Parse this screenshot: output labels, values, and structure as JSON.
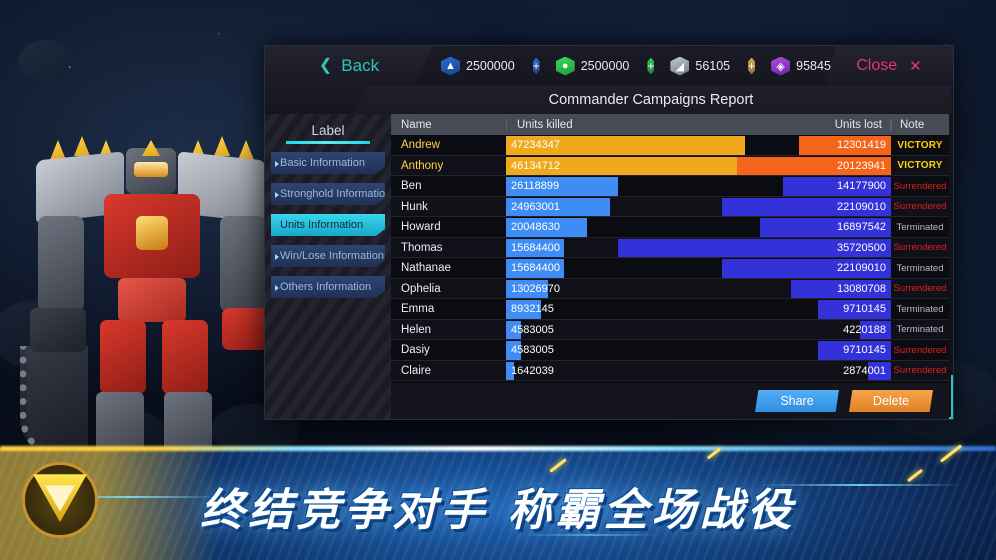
{
  "window": {
    "back_label": "Back",
    "back_icon": "chevron-left-icon",
    "close_label": "Close",
    "close_icon": "close-x-icon",
    "title": "Commander Campaigns Report"
  },
  "resources": [
    {
      "icon": "crystal-blue-icon",
      "value": "2500000",
      "add_label": "+"
    },
    {
      "icon": "gas-green-icon",
      "value": "2500000",
      "add_label": "+"
    },
    {
      "icon": "metal-steel-icon",
      "value": "56105",
      "add_label": "+"
    },
    {
      "icon": "energy-purple-icon",
      "value": "95845",
      "add_label": "+"
    }
  ],
  "sidebar": {
    "header": "Label",
    "items": [
      {
        "label": "Basic Information",
        "active": false
      },
      {
        "label": "Stronghold Information",
        "active": false
      },
      {
        "label": "Units Information",
        "active": true
      },
      {
        "label": "Win/Lose Information",
        "active": false
      },
      {
        "label": "Others Information",
        "active": false
      }
    ]
  },
  "table": {
    "columns": [
      "Name",
      "Units killed",
      "Units lost",
      "Note"
    ],
    "rows": [
      {
        "name": "Andrew",
        "killed": "47234347",
        "lost": "12301419",
        "note": "VICTORY",
        "note_type": "victory",
        "killed_pct": 62,
        "lost_pct": 24
      },
      {
        "name": "Anthony",
        "killed": "46134712",
        "lost": "20123941",
        "note": "VICTORY",
        "note_type": "victory",
        "killed_pct": 60,
        "lost_pct": 40
      },
      {
        "name": "Ben",
        "killed": "26118899",
        "lost": "14177900",
        "note": "Surrendered",
        "note_type": "surrendered",
        "killed_pct": 29,
        "lost_pct": 28
      },
      {
        "name": "Hunk",
        "killed": "24963001",
        "lost": "22109010",
        "note": "Surrendered",
        "note_type": "surrendered",
        "killed_pct": 27,
        "lost_pct": 44
      },
      {
        "name": "Howard",
        "killed": "20048630",
        "lost": "16897542",
        "note": "Terminated",
        "note_type": "terminated",
        "killed_pct": 21,
        "lost_pct": 34
      },
      {
        "name": "Thomas",
        "killed": "15684400",
        "lost": "35720500",
        "note": "Surrendered",
        "note_type": "surrendered",
        "killed_pct": 15,
        "lost_pct": 71
      },
      {
        "name": "Nathanae",
        "killed": "15684400",
        "lost": "22109010",
        "note": "Terminated",
        "note_type": "terminated",
        "killed_pct": 15,
        "lost_pct": 44
      },
      {
        "name": "Ophelia",
        "killed": "13026970",
        "lost": "13080708",
        "note": "Surrendered",
        "note_type": "surrendered",
        "killed_pct": 11,
        "lost_pct": 26
      },
      {
        "name": "Emma",
        "killed": "8932145",
        "lost": "9710145",
        "note": "Terminated",
        "note_type": "terminated",
        "killed_pct": 9,
        "lost_pct": 19
      },
      {
        "name": "Helen",
        "killed": "4583005",
        "lost": "4220188",
        "note": "Terminated",
        "note_type": "terminated",
        "killed_pct": 4,
        "lost_pct": 8
      },
      {
        "name": "Dasiy",
        "killed": "4583005",
        "lost": "9710145",
        "note": "Surrendered",
        "note_type": "surrendered",
        "killed_pct": 4,
        "lost_pct": 19
      },
      {
        "name": "Claire",
        "killed": "1642039",
        "lost": "2874001",
        "note": "Surrendered",
        "note_type": "surrendered",
        "killed_pct": 2,
        "lost_pct": 6
      }
    ]
  },
  "footer": {
    "share_label": "Share",
    "delete_label": "Delete"
  },
  "banner": {
    "headline": "终结竞争对手  称霸全场战役",
    "emblem_icon": "faction-triangle-emblem-icon"
  },
  "colors": {
    "accent_teal": "#2ec6b8",
    "close_pink": "#e8356d",
    "killed_gold": "#f0a81c",
    "killed_blue": "#3f8cf5",
    "lost_orange": "#f4651a",
    "lost_blue": "#3232d8",
    "victory_yellow": "#ffd400",
    "surrendered_red": "#e02020",
    "terminated_grey": "#b9bdc6",
    "share_blue": "#52aef5",
    "delete_orange": "#f5a349"
  }
}
